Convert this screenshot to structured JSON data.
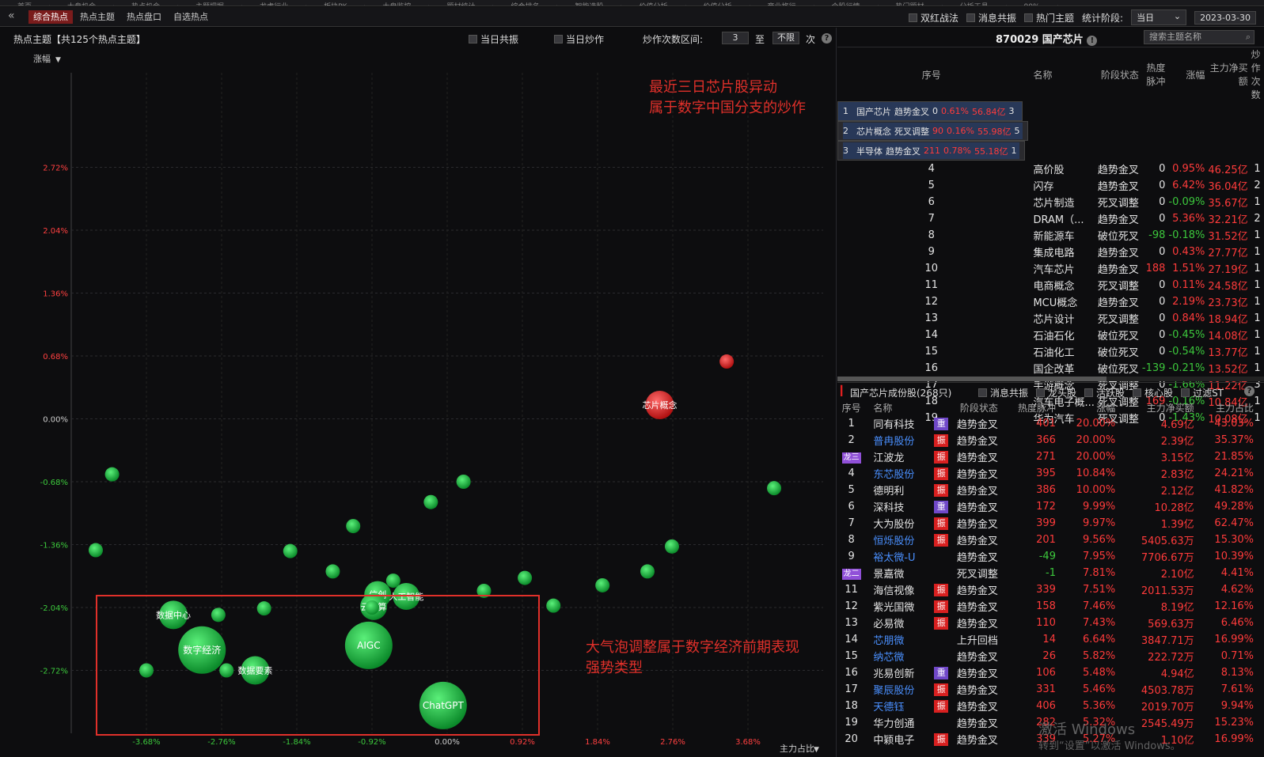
{
  "menubar": [
    "首页",
    "大盘机会",
    "热点机会",
    "主题把握",
    "龙虎行业",
    "板块PK",
    "大盘监控",
    "题材统计",
    "综合排名",
    "智能选股",
    "价值分析",
    "价值分析",
    "商业旅行",
    "个股行情",
    "热门题材",
    "分析工具",
    "90%"
  ],
  "subtabs": [
    "综合热点",
    "热点主题",
    "热点盘口",
    "自选热点"
  ],
  "top_right": {
    "opt1": "双红战法",
    "opt2": "消息共振",
    "opt3": "热门主题",
    "stage_label": "统计阶段:",
    "stage_value": "当日",
    "date": "2023-03-30"
  },
  "left_header": {
    "title": "热点主题【共125个热点主题】",
    "opt1": "当日共振",
    "opt2": "当日炒作",
    "range_label": "炒作次数区间:",
    "range_from": "3",
    "range_to_label": "至",
    "range_to": "不限",
    "unit": "次"
  },
  "chart_data": {
    "type": "scatter",
    "ylabel": "涨幅",
    "xlabel": "主力占比",
    "y_ticks": [
      "2.72%",
      "2.04%",
      "1.36%",
      "0.68%",
      "0.00%",
      "-0.68%",
      "-1.36%",
      "-2.04%",
      "-2.72%"
    ],
    "x_ticks": [
      "-3.68%",
      "-2.76%",
      "-1.84%",
      "-0.92%",
      "0.00%",
      "0.92%",
      "1.84%",
      "2.76%",
      "3.68%"
    ],
    "points": [
      {
        "x": 3.42,
        "y": 0.62,
        "r": 9,
        "color": "red",
        "label": ""
      },
      {
        "x": 2.6,
        "y": 0.15,
        "r": 18,
        "color": "red",
        "label": "芯片概念"
      },
      {
        "x": -4.1,
        "y": -0.6,
        "r": 9,
        "color": "green",
        "label": ""
      },
      {
        "x": -4.3,
        "y": -1.42,
        "r": 9,
        "color": "green",
        "label": ""
      },
      {
        "x": 4.0,
        "y": -0.75,
        "r": 9,
        "color": "green",
        "label": ""
      },
      {
        "x": 0.2,
        "y": -0.68,
        "r": 9,
        "color": "green",
        "label": ""
      },
      {
        "x": -0.2,
        "y": -0.9,
        "r": 9,
        "color": "green",
        "label": ""
      },
      {
        "x": -1.15,
        "y": -1.16,
        "r": 9,
        "color": "green",
        "label": ""
      },
      {
        "x": -1.92,
        "y": -1.43,
        "r": 9,
        "color": "green",
        "label": ""
      },
      {
        "x": -1.4,
        "y": -1.65,
        "r": 9,
        "color": "green",
        "label": ""
      },
      {
        "x": -0.66,
        "y": -1.75,
        "r": 9,
        "color": "green",
        "label": ""
      },
      {
        "x": 0.45,
        "y": -1.86,
        "r": 9,
        "color": "green",
        "label": ""
      },
      {
        "x": 0.95,
        "y": -1.72,
        "r": 9,
        "color": "green",
        "label": ""
      },
      {
        "x": 1.3,
        "y": -2.02,
        "r": 9,
        "color": "green",
        "label": ""
      },
      {
        "x": 1.9,
        "y": -1.8,
        "r": 9,
        "color": "green",
        "label": ""
      },
      {
        "x": 2.45,
        "y": -1.65,
        "r": 9,
        "color": "green",
        "label": ""
      },
      {
        "x": 2.75,
        "y": -1.38,
        "r": 9,
        "color": "green",
        "label": ""
      },
      {
        "x": -0.85,
        "y": -1.9,
        "r": 17,
        "color": "green",
        "label": "信创"
      },
      {
        "x": -0.9,
        "y": -2.03,
        "r": 17,
        "color": "green",
        "label": "云计算"
      },
      {
        "x": -0.5,
        "y": -1.92,
        "r": 17,
        "color": "green",
        "label": "人工智能"
      },
      {
        "x": -0.92,
        "y": -2.04,
        "r": 9,
        "color": "green",
        "label": ""
      },
      {
        "x": -2.24,
        "y": -2.05,
        "r": 9,
        "color": "green",
        "label": ""
      },
      {
        "x": -2.8,
        "y": -2.12,
        "r": 9,
        "color": "green",
        "label": ""
      },
      {
        "x": -3.35,
        "y": -2.12,
        "r": 18,
        "color": "green",
        "label": "数据中心"
      },
      {
        "x": -3.68,
        "y": -2.72,
        "r": 9,
        "color": "green",
        "label": ""
      },
      {
        "x": -2.7,
        "y": -2.72,
        "r": 9,
        "color": "green",
        "label": ""
      },
      {
        "x": -3.0,
        "y": -2.5,
        "r": 30,
        "color": "green",
        "label": "数字经济"
      },
      {
        "x": -2.35,
        "y": -2.72,
        "r": 18,
        "color": "green",
        "label": "数据要素"
      },
      {
        "x": -0.96,
        "y": -2.45,
        "r": 30,
        "color": "green",
        "label": "AIGC"
      },
      {
        "x": -0.05,
        "y": -3.1,
        "r": 30,
        "color": "green",
        "label": "ChatGPT"
      }
    ]
  },
  "annotations": {
    "top_line1": "最近三日芯片股异动",
    "top_line2": "属于数字中国分支的炒作",
    "bottom_line1": "大气泡调整属于数字经济前期表现",
    "bottom_line2": "强势类型"
  },
  "right_top": {
    "title": "870029 国产芯片",
    "search_placeholder": "搜索主题名称",
    "columns": [
      "序号",
      "名称",
      "阶段状态",
      "热度脉冲",
      "涨幅",
      "主力净买额",
      "炒作次数"
    ],
    "rows": [
      [
        "1",
        "国产芯片",
        "趋势金叉",
        "0",
        "0.61%",
        "56.84亿",
        "3"
      ],
      [
        "2",
        "芯片概念",
        "死叉调整",
        "90",
        "0.16%",
        "55.98亿",
        "5"
      ],
      [
        "3",
        "半导体",
        "趋势金叉",
        "211",
        "0.78%",
        "55.18亿",
        "1"
      ],
      [
        "4",
        "高价股",
        "趋势金叉",
        "0",
        "0.95%",
        "46.25亿",
        "1"
      ],
      [
        "5",
        "闪存",
        "趋势金叉",
        "0",
        "6.42%",
        "36.04亿",
        "2"
      ],
      [
        "6",
        "芯片制造",
        "死叉调整",
        "0",
        "-0.09%",
        "35.67亿",
        "1"
      ],
      [
        "7",
        "DRAM（...",
        "趋势金叉",
        "0",
        "5.36%",
        "32.21亿",
        "2"
      ],
      [
        "8",
        "新能源车",
        "破位死叉",
        "-98",
        "-0.18%",
        "31.52亿",
        "1"
      ],
      [
        "9",
        "集成电路",
        "趋势金叉",
        "0",
        "0.43%",
        "27.77亿",
        "1"
      ],
      [
        "10",
        "汽车芯片",
        "趋势金叉",
        "188",
        "1.51%",
        "27.19亿",
        "1"
      ],
      [
        "11",
        "电商概念",
        "死叉调整",
        "0",
        "0.11%",
        "24.58亿",
        "1"
      ],
      [
        "12",
        "MCU概念",
        "趋势金叉",
        "0",
        "2.19%",
        "23.73亿",
        "1"
      ],
      [
        "13",
        "芯片设计",
        "死叉调整",
        "0",
        "0.84%",
        "18.94亿",
        "1"
      ],
      [
        "14",
        "石油石化",
        "破位死叉",
        "0",
        "-0.45%",
        "14.08亿",
        "1"
      ],
      [
        "15",
        "石油化工",
        "破位死叉",
        "0",
        "-0.54%",
        "13.77亿",
        "1"
      ],
      [
        "16",
        "国企改革",
        "破位死叉",
        "-139",
        "-0.21%",
        "13.52亿",
        "1"
      ],
      [
        "17",
        "手游概念",
        "死叉调整",
        "0",
        "-1.66%",
        "11.22亿",
        "3"
      ],
      [
        "18",
        "汽车电子概...",
        "死叉调整",
        "169",
        "-0.16%",
        "10.84亿",
        "1"
      ],
      [
        "19",
        "华为汽车",
        "死叉调整",
        "0",
        "-1.43%",
        "10.08亿",
        "1"
      ]
    ]
  },
  "right_bottom": {
    "title": "国产芯片成份股(268只)",
    "opts": [
      "消息共振",
      "龙头股",
      "活跃股",
      "核心股",
      "过滤ST"
    ],
    "columns": [
      "序号",
      "名称",
      "阶段状态",
      "热度脉冲",
      "涨幅",
      "主力净买额",
      "主力占比"
    ],
    "rows": [
      [
        "1",
        "同有科技",
        "重",
        "趋势金叉",
        "401",
        "20.00%",
        "4.69亿",
        "43.03%"
      ],
      [
        "2",
        "普冉股份",
        "振",
        "趋势金叉",
        "366",
        "20.00%",
        "2.39亿",
        "35.37%"
      ],
      [
        "龙三",
        "江波龙",
        "振",
        "趋势金叉",
        "271",
        "20.00%",
        "3.15亿",
        "21.85%"
      ],
      [
        "4",
        "东芯股份",
        "振",
        "趋势金叉",
        "395",
        "10.84%",
        "2.83亿",
        "24.21%"
      ],
      [
        "5",
        "德明利",
        "振",
        "趋势金叉",
        "386",
        "10.00%",
        "2.12亿",
        "41.82%"
      ],
      [
        "6",
        "深科技",
        "重",
        "趋势金叉",
        "172",
        "9.99%",
        "10.28亿",
        "49.28%"
      ],
      [
        "7",
        "大为股份",
        "振",
        "趋势金叉",
        "399",
        "9.97%",
        "1.39亿",
        "62.47%"
      ],
      [
        "8",
        "恒烁股份",
        "振",
        "趋势金叉",
        "201",
        "9.56%",
        "5405.63万",
        "15.30%"
      ],
      [
        "9",
        "裕太微-U",
        "",
        "趋势金叉",
        "-49",
        "7.95%",
        "7706.67万",
        "10.39%"
      ],
      [
        "龙二",
        "景嘉微",
        "",
        "死叉调整",
        "-1",
        "7.81%",
        "2.10亿",
        "4.41%"
      ],
      [
        "11",
        "海信视像",
        "振",
        "趋势金叉",
        "339",
        "7.51%",
        "2011.53万",
        "4.62%"
      ],
      [
        "12",
        "紫光国微",
        "振",
        "趋势金叉",
        "158",
        "7.46%",
        "8.19亿",
        "12.16%"
      ],
      [
        "13",
        "必易微",
        "振",
        "趋势金叉",
        "110",
        "7.43%",
        "569.63万",
        "6.46%"
      ],
      [
        "14",
        "芯朋微",
        "",
        "上升回档",
        "14",
        "6.64%",
        "3847.71万",
        "16.99%"
      ],
      [
        "15",
        "纳芯微",
        "",
        "趋势金叉",
        "26",
        "5.82%",
        "222.72万",
        "0.71%"
      ],
      [
        "16",
        "兆易创新",
        "重",
        "趋势金叉",
        "106",
        "5.48%",
        "4.94亿",
        "8.13%"
      ],
      [
        "17",
        "聚辰股份",
        "振",
        "趋势金叉",
        "331",
        "5.46%",
        "4503.78万",
        "7.61%"
      ],
      [
        "18",
        "天德钰",
        "振",
        "趋势金叉",
        "406",
        "5.36%",
        "2019.70万",
        "9.94%"
      ],
      [
        "19",
        "华力创通",
        "",
        "趋势金叉",
        "282",
        "5.32%",
        "2545.49万",
        "15.23%"
      ],
      [
        "20",
        "中颖电子",
        "振",
        "趋势金叉",
        "339",
        "5.27%",
        "1.10亿",
        "16.99%"
      ]
    ]
  },
  "watermark": {
    "line1": "激活 Windows",
    "line2": "转到“设置”以激活 Windows。"
  }
}
